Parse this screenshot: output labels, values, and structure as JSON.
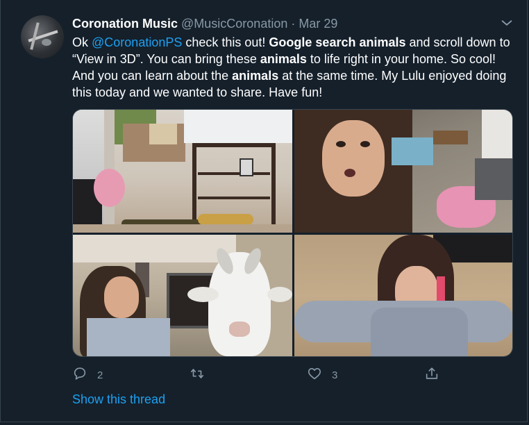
{
  "tweet": {
    "author_name": "Coronation Music",
    "author_handle": "@MusicCoronation",
    "separator": "·",
    "date": "Mar 29",
    "text_parts": {
      "p1": "Ok ",
      "mention": "@CoronationPS",
      "p2": " check this out! ",
      "b1": "Google search animals",
      "p3": " and scroll down to “View in 3D”. You can bring these ",
      "b2": "animals",
      "p4": " to life right in your home. So cool! And you can learn about the ",
      "b3": "animals",
      "p5": " at the same time. My Lulu enjoyed doing this today and we wanted to share. Have fun!"
    },
    "media_count": 4,
    "actions": {
      "reply_count": "2",
      "retweet_count": "",
      "like_count": "3",
      "share_count": ""
    },
    "show_thread": "Show this thread"
  },
  "colors": {
    "background": "#15202b",
    "accent": "#1da1f2",
    "muted": "#8899a6",
    "border": "#38444d"
  },
  "icons": [
    "chevron-down-icon",
    "reply-icon",
    "retweet-icon",
    "like-icon",
    "share-icon"
  ]
}
